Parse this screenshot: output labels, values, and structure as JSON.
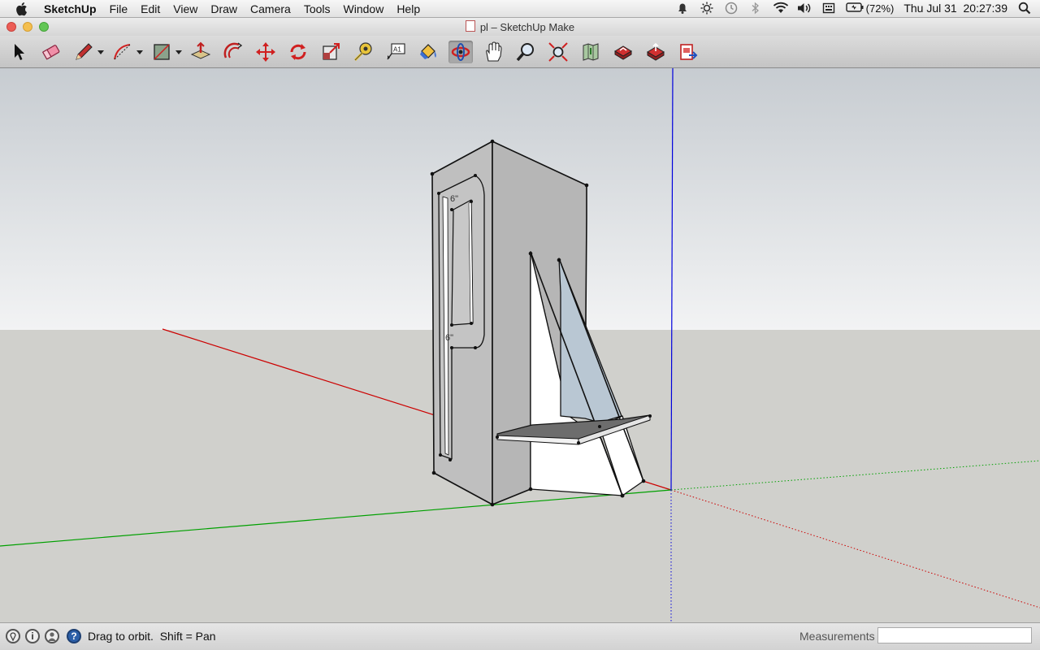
{
  "menubar": {
    "app": "SketchUp",
    "items": [
      "File",
      "Edit",
      "View",
      "Draw",
      "Camera",
      "Tools",
      "Window",
      "Help"
    ],
    "battery": "(72%)",
    "clock": "Thu Jul 31  20:27:39"
  },
  "window": {
    "title": "pl – SketchUp Make"
  },
  "toolbar": {
    "tools": [
      "select-tool",
      "eraser-tool",
      "line-tool",
      "arc-tool",
      "rectangle-tool",
      "push-pull-tool",
      "offset-tool",
      "move-tool",
      "rotate-tool",
      "scale-tool",
      "tape-measure-tool",
      "text-tool",
      "paint-bucket-tool",
      "orbit-tool",
      "pan-tool",
      "zoom-tool",
      "zoom-extents-tool",
      "add-location-tool",
      "3d-warehouse-tool",
      "share-model-tool",
      "send-to-layout-tool"
    ],
    "active_tool": "orbit-tool"
  },
  "model": {
    "dimension_top": "6\"",
    "dimension_bottom": "6\""
  },
  "statusbar": {
    "hint": "Drag to orbit.  Shift = Pan",
    "measurements_label": "Measurements",
    "measurements_value": ""
  },
  "colors": {
    "sky_top": "#c7ccd1",
    "sky_bottom": "#f2f3f4",
    "ground": "#d0d0cc",
    "x_axis": "#cc0000",
    "y_axis": "#00a000",
    "z_axis": "#0000dd"
  }
}
